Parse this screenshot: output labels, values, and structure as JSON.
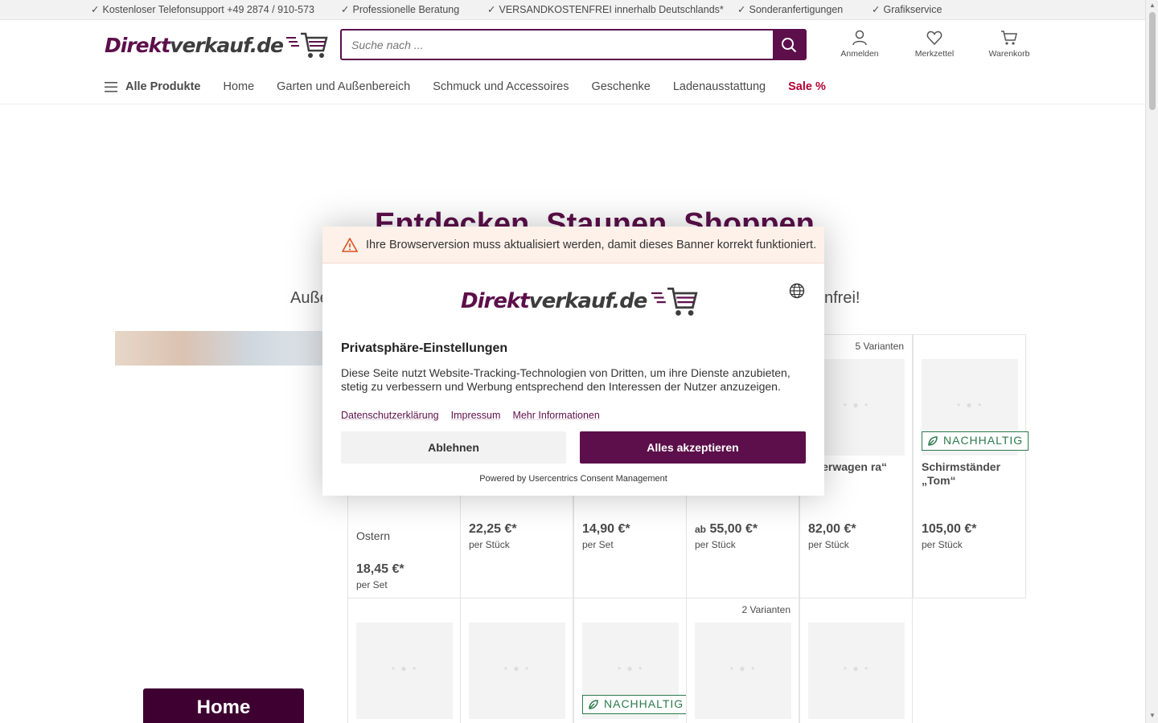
{
  "topbar": {
    "items": [
      "Kostenloser Telefonsupport +49 2874 / 910-573",
      "Professionelle Beratung",
      "VERSANDKOSTENFREI innerhalb Deutschlands*",
      "Sonderanfertigungen",
      "Grafikservice"
    ],
    "check": "✓"
  },
  "header": {
    "logo": {
      "part1": "Direkt",
      "part2": "verkauf.de"
    },
    "search": {
      "placeholder": "Suche nach ..."
    },
    "icons": {
      "account": "Anmelden",
      "wishlist": "Merkzettel",
      "cart": "Warenkorb"
    }
  },
  "nav": {
    "all_products": "Alle Produkte",
    "items": [
      "Home",
      "Garten und Außenbereich",
      "Schmuck und Accessoires",
      "Geschenke",
      "Ladenausstattung"
    ],
    "sale": "Sale %"
  },
  "hero": {
    "title": "Entdecken. Staunen. Shoppen.",
    "subtitle_start": "Auße",
    "subtitle_end": "nfrei!"
  },
  "home_button": "Home",
  "products": [
    {
      "category": "Ostern",
      "price": "18,45 €*",
      "unit": "per Set"
    },
    {
      "price": "22,25 €*",
      "unit": "per Stück"
    },
    {
      "price": "14,90 €*",
      "unit": "per Set"
    },
    {
      "price_prefix": "ab",
      "price": "55,00 €*",
      "unit": "per Stück"
    },
    {
      "variants": "5 Varianten",
      "name": "rvierwagen ra“",
      "price": "82,00 €*",
      "unit": "per Stück"
    },
    {
      "badge": "NACHHALTIG",
      "name": "Schirmständer „Tom“",
      "price": "105,00 €*",
      "unit": "per Stück"
    }
  ],
  "products_row2": [
    {},
    {},
    {
      "badge": "NACHHALTIG"
    },
    {
      "variants": "2 Varianten"
    },
    {}
  ],
  "consent": {
    "warning": "Ihre Browserversion muss aktualisiert werden, damit dieses Banner korrekt funktioniert.",
    "title": "Privatsphäre-Einstellungen",
    "text": "Diese Seite nutzt Website-Tracking-Technologien von Dritten, um ihre Dienste anzubieten, stetig zu verbessern und Werbung entsprechend den Interessen der Nutzer anzuzeigen.",
    "links": [
      "Datenschutzerklärung",
      "Impressum",
      "Mehr Informationen"
    ],
    "decline": "Ablehnen",
    "accept": "Alles akzeptieren",
    "powered": "Powered by Usercentrics Consent Management"
  },
  "colors": {
    "brand": "#5c0f4a",
    "sale": "#b30033",
    "eco": "#2b7a4b"
  }
}
